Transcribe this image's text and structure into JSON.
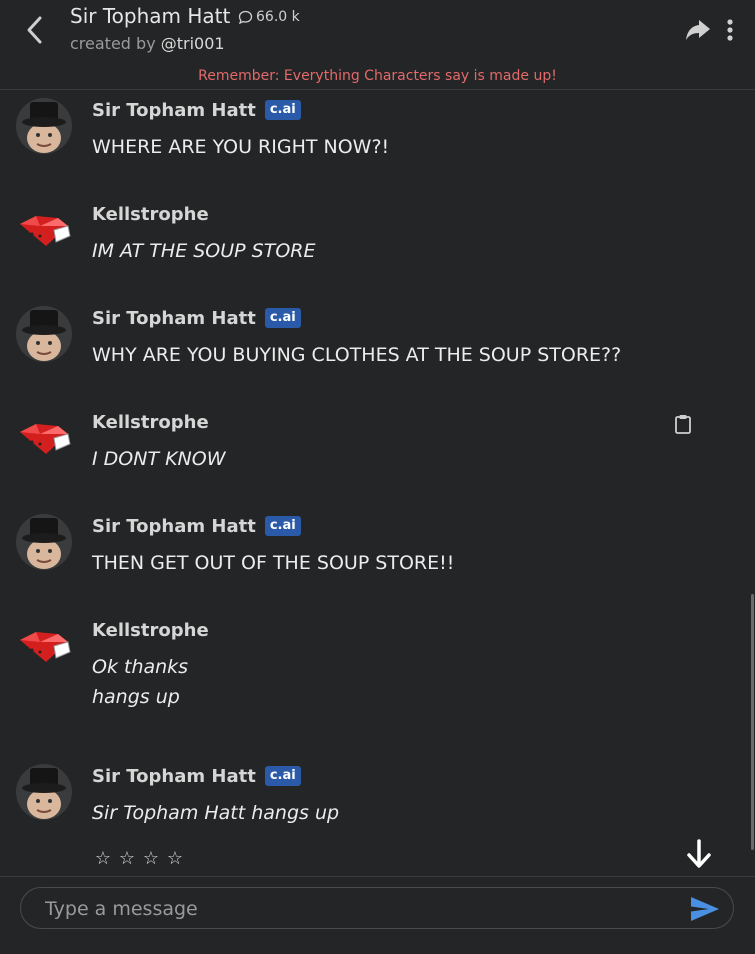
{
  "header": {
    "title": "Sir Topham Hatt",
    "chat_count": "66.0 k",
    "created_by_prefix": "created by",
    "creator": "@tri001",
    "disclaimer": "Remember: Everything Characters say is made up!"
  },
  "messages": [
    {
      "author": "Sir Topham Hatt",
      "badge": "c.ai",
      "text": "WHERE ARE YOU RIGHT NOW?!"
    },
    {
      "author": "Kellstrophe",
      "text": "IM AT THE SOUP STORE"
    },
    {
      "author": "Sir Topham Hatt",
      "badge": "c.ai",
      "text": "WHY ARE YOU BUYING CLOTHES AT THE SOUP STORE??"
    },
    {
      "author": "Kellstrophe",
      "text": "I DONT KNOW"
    },
    {
      "author": "Sir Topham Hatt",
      "badge": "c.ai",
      "text": "THEN GET OUT OF THE SOUP STORE!!"
    },
    {
      "author": "Kellstrophe",
      "text_line1": "Ok thanks",
      "text_line2": "hangs up"
    },
    {
      "author": "Sir Topham Hatt",
      "badge": "c.ai",
      "text": "Sir Topham Hatt hangs up"
    }
  ],
  "rating": {
    "stars": [
      "☆",
      "☆",
      "☆",
      "☆"
    ]
  },
  "composer": {
    "placeholder": "Type a message"
  },
  "icons": {
    "back": "chevron-left-icon",
    "chat": "speech-bubble-icon",
    "share": "share-arrow-icon",
    "more": "vertical-dots-icon",
    "copy": "clipboard-icon",
    "scroll_down": "arrow-down-icon",
    "send": "send-icon"
  },
  "colors": {
    "background": "#242526",
    "disclaimer": "#e26a6a",
    "badge": "#2b5aa8",
    "send": "#4a90e2"
  }
}
